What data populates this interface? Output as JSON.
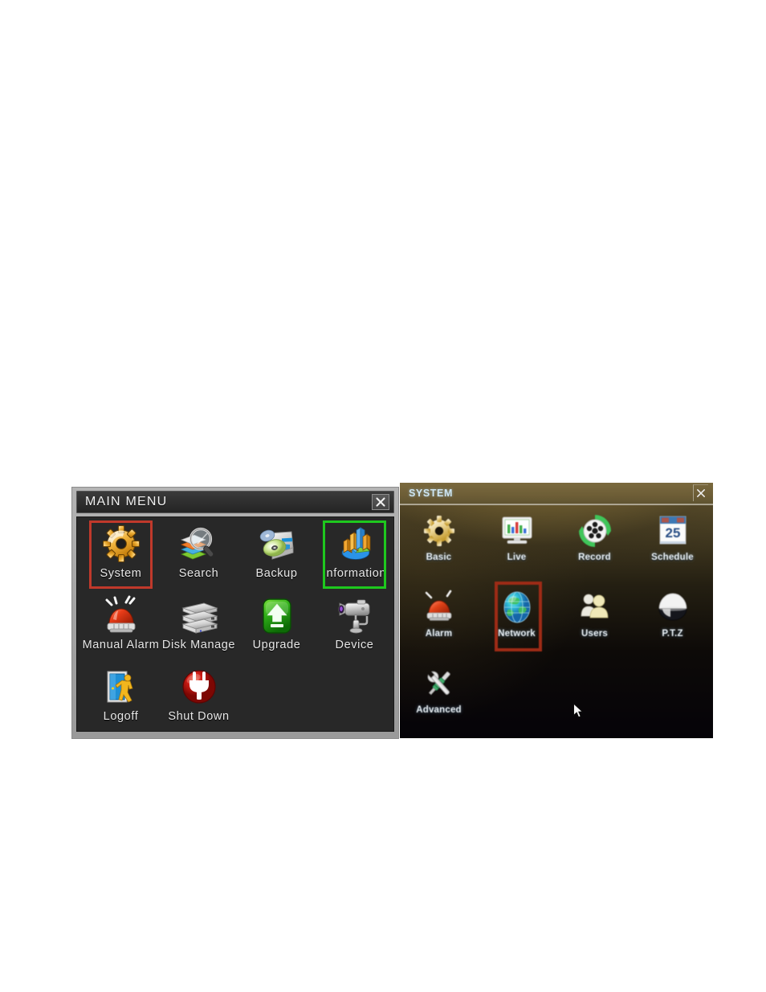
{
  "main_menu": {
    "title": "MAIN MENU",
    "close_label": "close-window",
    "items": [
      {
        "label": "System",
        "icon": "gear-icon",
        "selected": "red"
      },
      {
        "label": "Search",
        "icon": "magnifier-books-icon",
        "selected": "none"
      },
      {
        "label": "Backup",
        "icon": "disc-drive-icon",
        "selected": "none"
      },
      {
        "label": "Information",
        "icon": "bar-pie-chart-icon",
        "selected": "green"
      },
      {
        "label": "Manual Alarm",
        "icon": "alarm-siren-icon",
        "selected": "none"
      },
      {
        "label": "Disk Manage",
        "icon": "hard-disks-icon",
        "selected": "none"
      },
      {
        "label": "Upgrade",
        "icon": "up-arrow-icon",
        "selected": "none"
      },
      {
        "label": "Device",
        "icon": "camera-icon",
        "selected": "none"
      },
      {
        "label": "Logoff",
        "icon": "door-exit-icon",
        "selected": "none"
      },
      {
        "label": "Shut Down",
        "icon": "power-plug-icon",
        "selected": "none"
      }
    ]
  },
  "system_menu": {
    "title": "SYSTEM",
    "close_label": "close-window",
    "items": [
      {
        "label": "Basic",
        "icon": "gear-icon",
        "selected": "none"
      },
      {
        "label": "Live",
        "icon": "monitor-chart-icon",
        "selected": "none"
      },
      {
        "label": "Record",
        "icon": "film-reel-icon",
        "selected": "none"
      },
      {
        "label": "Schedule",
        "icon": "calendar-icon",
        "selected": "none",
        "calendar_day": "25"
      },
      {
        "label": "Alarm",
        "icon": "alarm-siren-icon",
        "selected": "none"
      },
      {
        "label": "Network",
        "icon": "globe-icon",
        "selected": "red"
      },
      {
        "label": "Users",
        "icon": "users-icon",
        "selected": "none"
      },
      {
        "label": "P.T.Z",
        "icon": "dome-camera-icon",
        "selected": "none"
      },
      {
        "label": "Advanced",
        "icon": "tools-icon",
        "selected": "none"
      }
    ],
    "cursor": "mouse-pointer"
  },
  "colors": {
    "selection_red": "#c0392b",
    "selection_green": "#1ec81e",
    "panel_bg": "#282828",
    "window_frame": "#a6a6a6",
    "sys_title_text": "#cfe6f2"
  }
}
